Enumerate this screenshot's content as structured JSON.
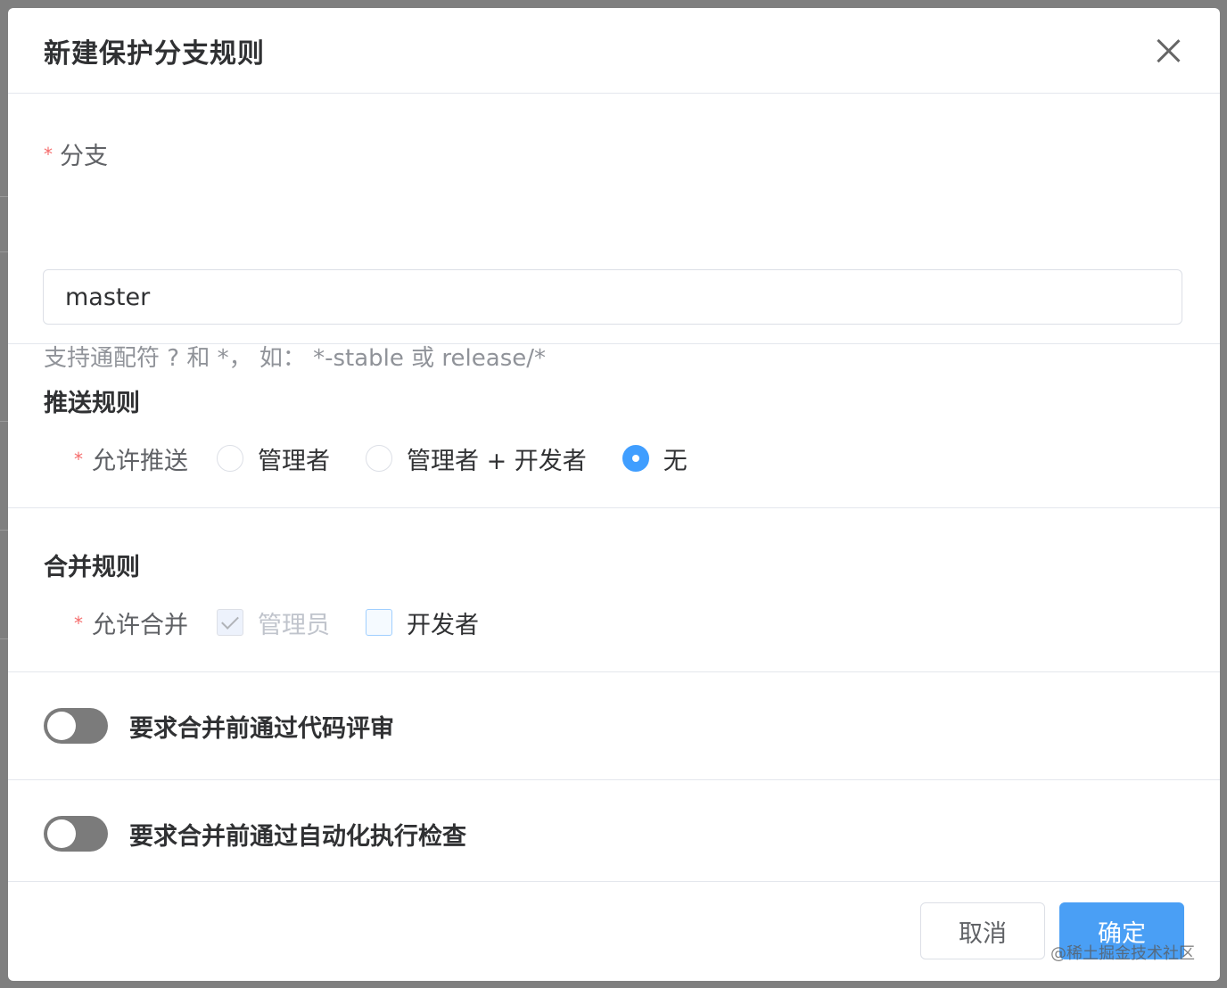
{
  "dialog": {
    "title": "新建保护分支规则"
  },
  "branch": {
    "required_mark": "*",
    "label": "分支",
    "value": "master",
    "hint": "支持通配符 ? 和 *， 如： *-stable 或 release/*"
  },
  "push_rules": {
    "title": "推送规则",
    "required_mark": "*",
    "label": "允许推送",
    "options": [
      {
        "label": "管理者",
        "checked": false
      },
      {
        "label": "管理者 + 开发者",
        "checked": false
      },
      {
        "label": "无",
        "checked": true
      }
    ]
  },
  "merge_rules": {
    "title": "合并规则",
    "required_mark": "*",
    "label": "允许合并",
    "options": [
      {
        "label": "管理员",
        "checked": true,
        "disabled": true
      },
      {
        "label": "开发者",
        "checked": false,
        "disabled": false
      }
    ]
  },
  "toggles": [
    {
      "label": "要求合并前通过代码评审",
      "on": false
    },
    {
      "label": "要求合并前通过自动化执行检查",
      "on": false
    }
  ],
  "footer": {
    "cancel_label": "取消",
    "confirm_label": "确定"
  },
  "watermark": "@稀土掘金技术社区",
  "colors": {
    "primary": "#409eff",
    "required": "#f56c6c",
    "switch_off": "#7b7b7b"
  }
}
